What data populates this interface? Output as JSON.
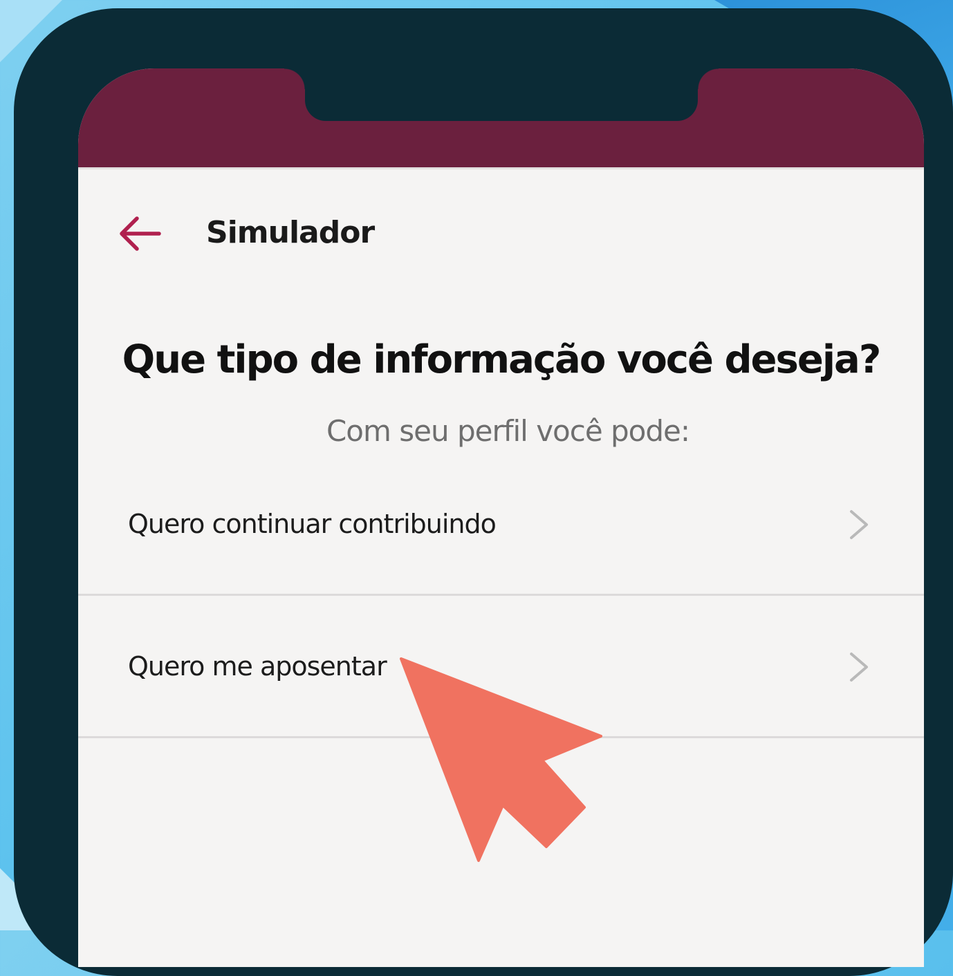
{
  "app": {
    "title": "Simulador"
  },
  "question": {
    "title": "Que tipo de informação você deseja?",
    "subtitle": "Com seu perfil você pode:"
  },
  "options": [
    {
      "label": "Quero continuar contribuindo",
      "icon": "chevron-right-icon"
    },
    {
      "label": "Quero me aposentar",
      "icon": "chevron-right-icon"
    }
  ],
  "icons": {
    "back": "arrow-left-icon",
    "pointer": "cursor-arrow-icon"
  },
  "colors": {
    "status_bar": "#6b203e",
    "accent": "#b0204e",
    "pointer": "#f07260",
    "device_frame": "#0b2b36",
    "screen_bg": "#f5f4f3"
  }
}
